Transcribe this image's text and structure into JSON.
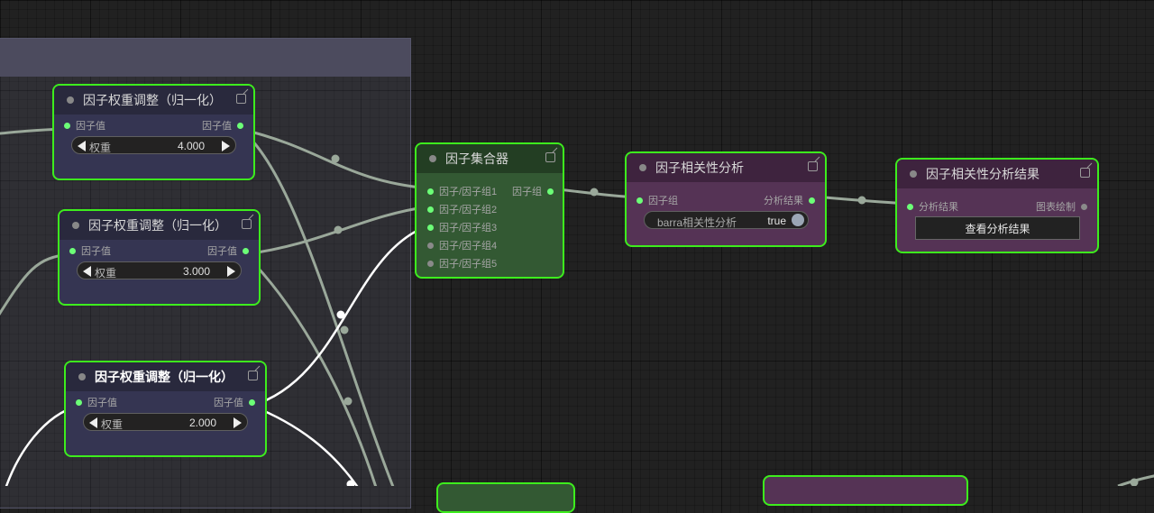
{
  "weight_nodes": [
    {
      "title": "因子权重调整（归一化）",
      "input_label": "因子值",
      "output_label": "因子值",
      "widget_label": "权重",
      "widget_value": "4.000"
    },
    {
      "title": "因子权重调整（归一化）",
      "input_label": "因子值",
      "output_label": "因子值",
      "widget_label": "权重",
      "widget_value": "3.000"
    },
    {
      "title": "因子权重调整（归一化）",
      "input_label": "因子值",
      "output_label": "因子值",
      "widget_label": "权重",
      "widget_value": "2.000"
    }
  ],
  "combine_node": {
    "title": "因子集合器",
    "inputs": [
      "因子/因子组1",
      "因子/因子组2",
      "因子/因子组3",
      "因子/因子组4",
      "因子/因子组5"
    ],
    "output_label": "因子组"
  },
  "corr_node": {
    "title": "因子相关性分析",
    "input_label": "因子组",
    "output_label": "分析结果",
    "toggle_label": "barra相关性分析",
    "toggle_value": "true"
  },
  "result_node": {
    "title": "因子相关性分析结果",
    "input_label": "分析结果",
    "output_label": "图表绘制",
    "button_label": "查看分析结果"
  },
  "colors": {
    "canvas_bg": "#212121",
    "selection_outline": "#3ded1d",
    "slot_connected": "#6cff77",
    "weight_node_bg": "#353552",
    "combine_node_bg": "#335933",
    "corr_node_bg": "#553355",
    "link_color": "#9aa89a",
    "highlight_link": "#ffffff"
  }
}
